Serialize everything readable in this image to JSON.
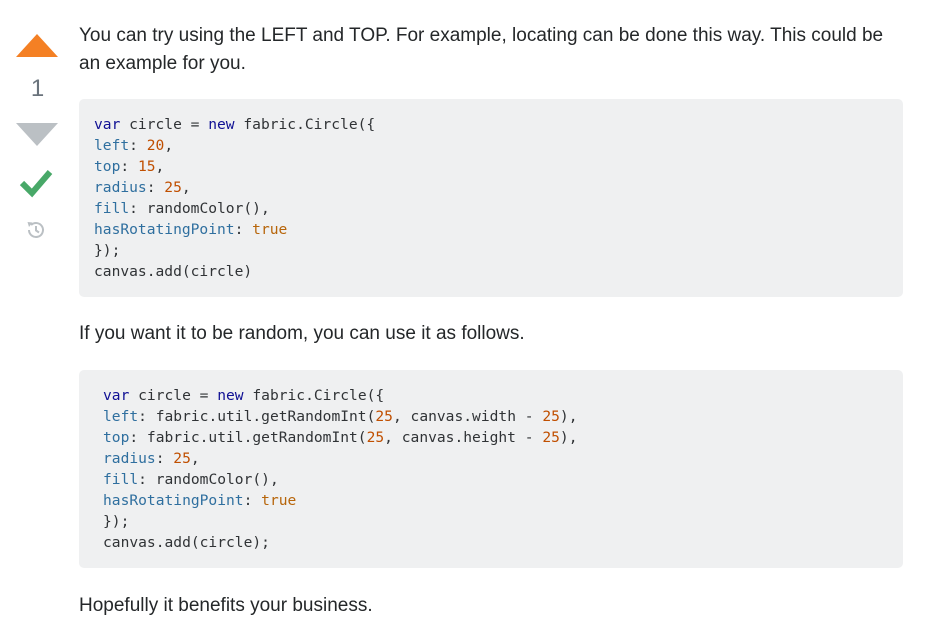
{
  "vote": {
    "count": "1",
    "upvote_color": "#f48024",
    "downvote_color": "#bbc0c4",
    "accepted_color": "#48a868"
  },
  "answer": {
    "para1": "You can try using the LEFT and TOP. For example, locating can be done this way. This could be an example for you.",
    "code1": [
      [
        {
          "t": "var",
          "c": "kw"
        },
        {
          "t": " circle = ",
          "c": ""
        },
        {
          "t": "new",
          "c": "kw"
        },
        {
          "t": " fabric.Circle({",
          "c": ""
        }
      ],
      [
        {
          "t": "left",
          "c": "pr"
        },
        {
          "t": ": ",
          "c": ""
        },
        {
          "t": "20",
          "c": "num"
        },
        {
          "t": ",",
          "c": ""
        }
      ],
      [
        {
          "t": "top",
          "c": "pr"
        },
        {
          "t": ": ",
          "c": ""
        },
        {
          "t": "15",
          "c": "num"
        },
        {
          "t": ",",
          "c": ""
        }
      ],
      [
        {
          "t": "radius",
          "c": "pr"
        },
        {
          "t": ": ",
          "c": ""
        },
        {
          "t": "25",
          "c": "num"
        },
        {
          "t": ",",
          "c": ""
        }
      ],
      [
        {
          "t": "fill",
          "c": "pr"
        },
        {
          "t": ": randomColor(),",
          "c": ""
        }
      ],
      [
        {
          "t": "hasRotatingPoint",
          "c": "pr"
        },
        {
          "t": ": ",
          "c": ""
        },
        {
          "t": "true",
          "c": "bool"
        }
      ],
      [
        {
          "t": "});",
          "c": ""
        }
      ],
      [
        {
          "t": "canvas.add(circle)",
          "c": ""
        }
      ]
    ],
    "para2": "If you want it to be random, you can use it as follows.",
    "code2": [
      [
        {
          "t": "var",
          "c": "kw"
        },
        {
          "t": " circle = ",
          "c": ""
        },
        {
          "t": "new",
          "c": "kw"
        },
        {
          "t": " fabric.Circle({",
          "c": ""
        }
      ],
      [
        {
          "t": "left",
          "c": "pr"
        },
        {
          "t": ": fabric.util.getRandomInt(",
          "c": ""
        },
        {
          "t": "25",
          "c": "num"
        },
        {
          "t": ", canvas.width - ",
          "c": ""
        },
        {
          "t": "25",
          "c": "num"
        },
        {
          "t": "),",
          "c": ""
        }
      ],
      [
        {
          "t": "top",
          "c": "pr"
        },
        {
          "t": ": fabric.util.getRandomInt(",
          "c": ""
        },
        {
          "t": "25",
          "c": "num"
        },
        {
          "t": ", canvas.height - ",
          "c": ""
        },
        {
          "t": "25",
          "c": "num"
        },
        {
          "t": "),",
          "c": ""
        }
      ],
      [
        {
          "t": "radius",
          "c": "pr"
        },
        {
          "t": ": ",
          "c": ""
        },
        {
          "t": "25",
          "c": "num"
        },
        {
          "t": ",",
          "c": ""
        }
      ],
      [
        {
          "t": "fill",
          "c": "pr"
        },
        {
          "t": ": randomColor(),",
          "c": ""
        }
      ],
      [
        {
          "t": "hasRotatingPoint",
          "c": "pr"
        },
        {
          "t": ": ",
          "c": ""
        },
        {
          "t": "true",
          "c": "bool"
        }
      ],
      [
        {
          "t": "});",
          "c": ""
        }
      ],
      [
        {
          "t": "canvas.add(circle);",
          "c": ""
        }
      ]
    ],
    "para3": "Hopefully it benefits your business."
  }
}
